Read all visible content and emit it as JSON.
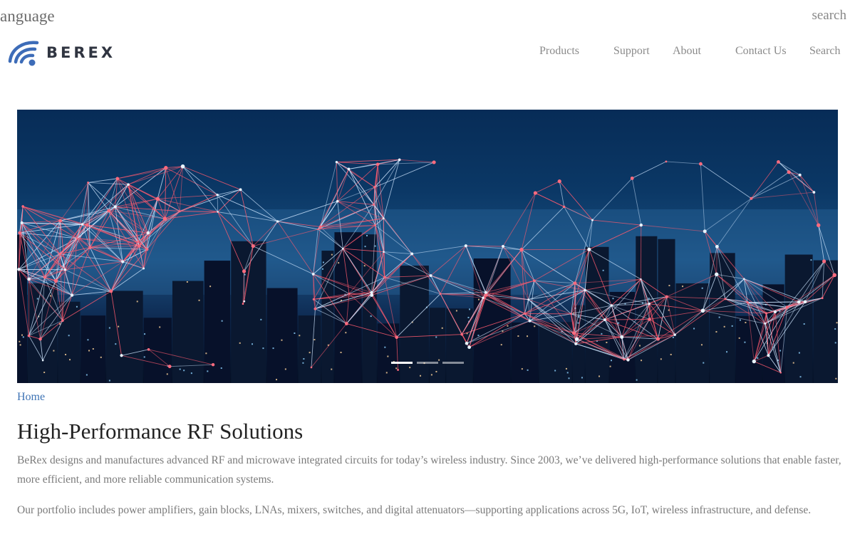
{
  "utility": {
    "language_label": "anguage",
    "search_label": "search"
  },
  "brand": {
    "name": "BEREX",
    "logo_color": "#3d6cb8",
    "text_color": "#303541"
  },
  "nav": {
    "items": [
      {
        "label": "Products"
      },
      {
        "label": "Support"
      },
      {
        "label": "About"
      },
      {
        "label": "Contact Us"
      },
      {
        "label": "Search"
      }
    ]
  },
  "hero": {
    "slide_count": 3,
    "active_slide": 1
  },
  "breadcrumb": {
    "home_label": "Home"
  },
  "main": {
    "title": "High-Performance RF Solutions",
    "paragraph_1": "BeRex designs and manufactures advanced RF and microwave integrated circuits for today’s wireless industry. Since 2003, we’ve delivered high-performance solutions that enable faster, more efficient, and more reliable communication systems.",
    "paragraph_2": "Our portfolio includes power amplifiers, gain blocks, LNAs, mixers, switches, and digital attenuators—supporting applications across 5G, IoT, wireless infrastructure, and defense."
  },
  "colors": {
    "link": "#3f74b5",
    "nav_text": "#8a8a8a",
    "body_text": "#7a7a7a",
    "hero_sky": "#0b3866"
  }
}
